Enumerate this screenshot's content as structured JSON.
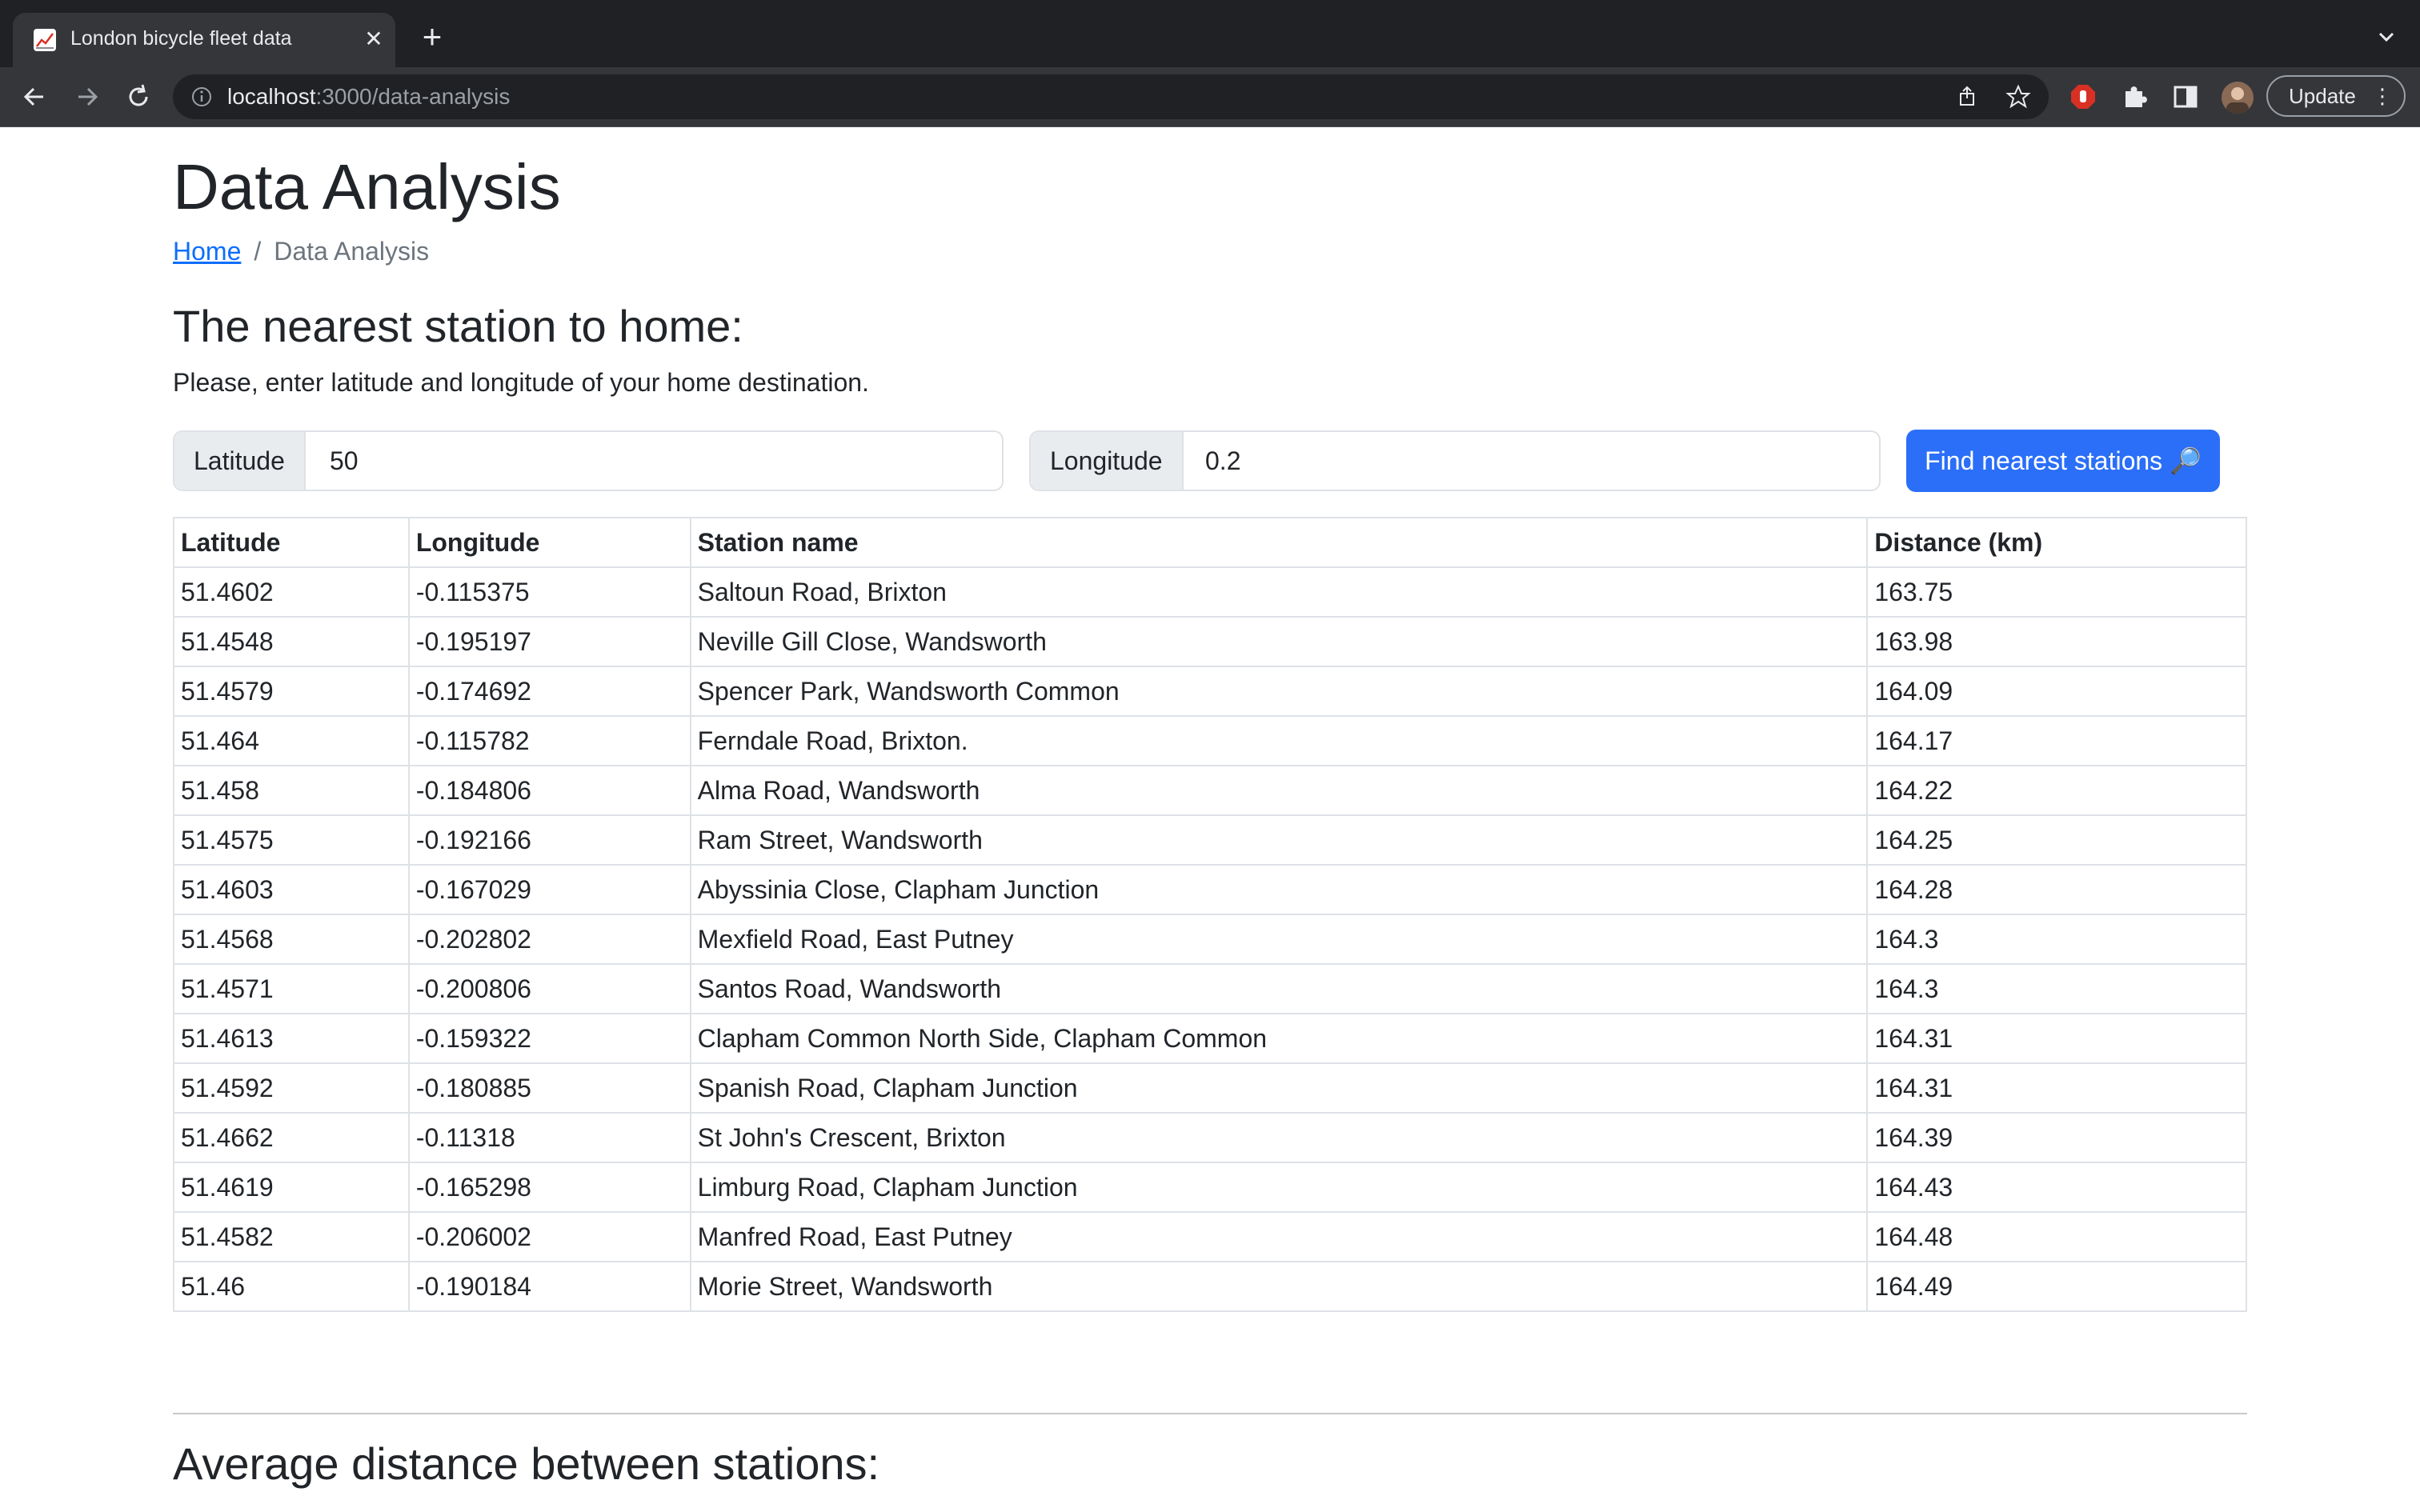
{
  "browser": {
    "tab_title": "London bicycle fleet data",
    "url_host": "localhost",
    "url_path": ":3000/data-analysis",
    "update_label": "Update"
  },
  "page": {
    "title": "Data Analysis",
    "breadcrumb": {
      "home": "Home",
      "separator": "/",
      "current": "Data Analysis"
    },
    "nearest": {
      "heading": "The nearest station to home:",
      "instruction": "Please, enter latitude and longitude of your home destination.",
      "latitude_label": "Latitude",
      "latitude_value": "50",
      "longitude_label": "Longitude",
      "longitude_value": "0.2",
      "button_label": "Find nearest stations 🔎"
    },
    "table": {
      "headers": [
        "Latitude",
        "Longitude",
        "Station name",
        "Distance (km)"
      ],
      "rows": [
        [
          "51.4602",
          "-0.115375",
          "Saltoun Road, Brixton",
          "163.75"
        ],
        [
          "51.4548",
          "-0.195197",
          "Neville Gill Close, Wandsworth",
          "163.98"
        ],
        [
          "51.4579",
          "-0.174692",
          "Spencer Park, Wandsworth Common",
          "164.09"
        ],
        [
          "51.464",
          "-0.115782",
          "Ferndale Road, Brixton.",
          "164.17"
        ],
        [
          "51.458",
          "-0.184806",
          "Alma Road, Wandsworth",
          "164.22"
        ],
        [
          "51.4575",
          "-0.192166",
          "Ram Street, Wandsworth",
          "164.25"
        ],
        [
          "51.4603",
          "-0.167029",
          "Abyssinia Close, Clapham Junction",
          "164.28"
        ],
        [
          "51.4568",
          "-0.202802",
          "Mexfield Road, East Putney",
          "164.3"
        ],
        [
          "51.4571",
          "-0.200806",
          "Santos Road, Wandsworth",
          "164.3"
        ],
        [
          "51.4613",
          "-0.159322",
          "Clapham Common North Side, Clapham Common",
          "164.31"
        ],
        [
          "51.4592",
          "-0.180885",
          "Spanish Road, Clapham Junction",
          "164.31"
        ],
        [
          "51.4662",
          "-0.11318",
          "St John's Crescent, Brixton",
          "164.39"
        ],
        [
          "51.4619",
          "-0.165298",
          "Limburg Road, Clapham Junction",
          "164.43"
        ],
        [
          "51.4582",
          "-0.206002",
          "Manfred Road, East Putney",
          "164.48"
        ],
        [
          "51.46",
          "-0.190184",
          "Morie Street, Wandsworth",
          "164.49"
        ]
      ]
    },
    "average": {
      "heading": "Average distance between stations:"
    }
  }
}
